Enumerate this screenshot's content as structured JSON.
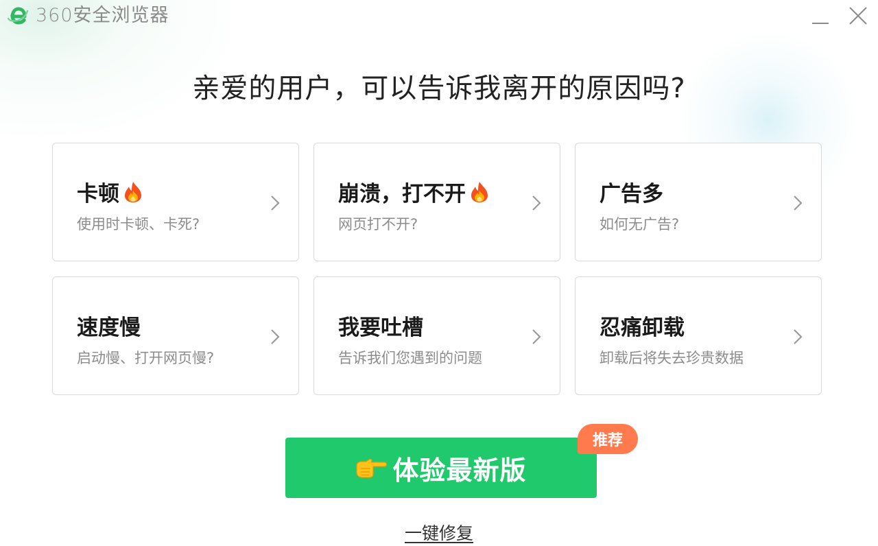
{
  "app": {
    "title": "360安全浏览器",
    "logo_icon": "browser-e-logo-icon"
  },
  "window_controls": {
    "minimize_icon": "minimize-icon",
    "close_icon": "close-icon"
  },
  "headline": "亲爱的用户，可以告诉我离开的原因吗?",
  "colors": {
    "accent": "#20c96b",
    "badge": "#ff7a4c",
    "logo": "#34b764"
  },
  "reasons": [
    {
      "title": "卡顿",
      "desc": "使用时卡顿、卡死?",
      "hot": true
    },
    {
      "title": "崩溃，打不开",
      "desc": "网页打不开?",
      "hot": true
    },
    {
      "title": "广告多",
      "desc": "如何无广告?",
      "hot": false
    },
    {
      "title": "速度慢",
      "desc": "启动慢、打开网页慢?",
      "hot": false
    },
    {
      "title": "我要吐槽",
      "desc": "告诉我们您遇到的问题",
      "hot": false
    },
    {
      "title": "忍痛卸载",
      "desc": "卸载后将失去珍贵数据",
      "hot": false
    }
  ],
  "cta": {
    "label": "体验最新版",
    "icon": "pointing-hand-icon",
    "badge": "推荐"
  },
  "repair_link": "一键修复"
}
